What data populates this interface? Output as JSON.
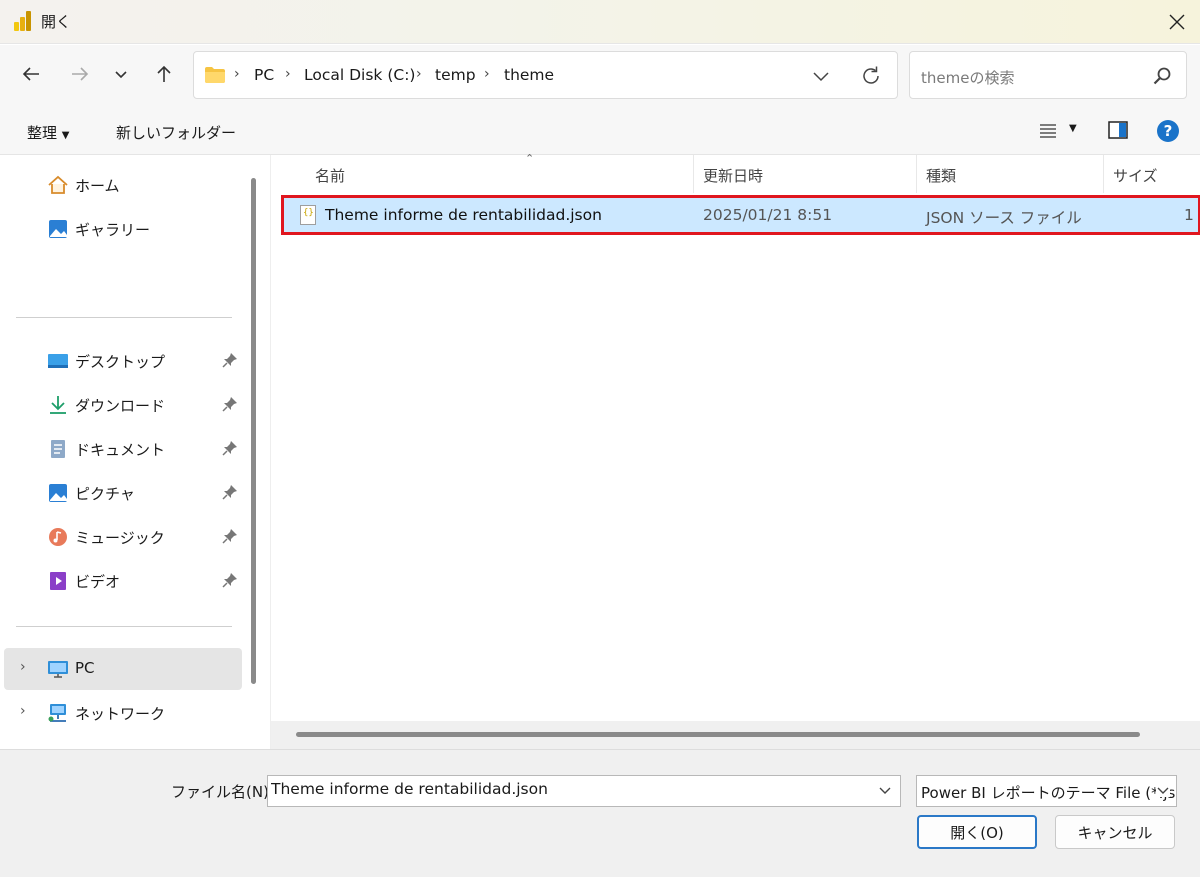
{
  "window": {
    "title": "開く",
    "brand_colors": [
      "#f2c811",
      "#e8b00f",
      "#c89400"
    ]
  },
  "navigation": {
    "back_icon": "arrow-left-icon",
    "forward_icon": "arrow-right-icon",
    "recent_icon": "chevron-down-icon",
    "up_icon": "arrow-up-icon",
    "breadcrumb": [
      "PC",
      "Local Disk (C:)",
      "temp",
      "theme"
    ],
    "search_placeholder": "themeの検索"
  },
  "toolbar": {
    "organize_label": "整理",
    "new_folder_label": "新しいフォルダー",
    "help_color": "#1a73c9"
  },
  "sidebar": {
    "quick": [
      {
        "label": "ホーム",
        "icon": "home-icon"
      },
      {
        "label": "ギャラリー",
        "icon": "gallery-icon"
      }
    ],
    "pinned": [
      {
        "label": "デスクトップ",
        "icon": "desktop-icon"
      },
      {
        "label": "ダウンロード",
        "icon": "download-icon"
      },
      {
        "label": "ドキュメント",
        "icon": "documents-icon"
      },
      {
        "label": "ピクチャ",
        "icon": "pictures-icon"
      },
      {
        "label": "ミュージック",
        "icon": "music-icon"
      },
      {
        "label": "ビデオ",
        "icon": "video-icon"
      }
    ],
    "locations": [
      {
        "label": "PC",
        "icon": "pc-icon"
      },
      {
        "label": "ネットワーク",
        "icon": "network-icon"
      }
    ]
  },
  "files": {
    "columns": [
      "名前",
      "更新日時",
      "種類",
      "サイズ"
    ],
    "rows": [
      {
        "name": "Theme informe de rentabilidad.json",
        "modified": "2025/01/21 8:51",
        "type": "JSON ソース ファイル",
        "size": "1"
      }
    ],
    "highlight_color": "#e0161f",
    "selection_color": "#cce8ff"
  },
  "footer": {
    "filename_label": "ファイル名(N):",
    "filename_value": "Theme informe de rentabilidad.json",
    "filetype_value": "Power BI レポートのテーマ File (*.json)",
    "open_label": "開く(O)",
    "cancel_label": "キャンセル"
  }
}
